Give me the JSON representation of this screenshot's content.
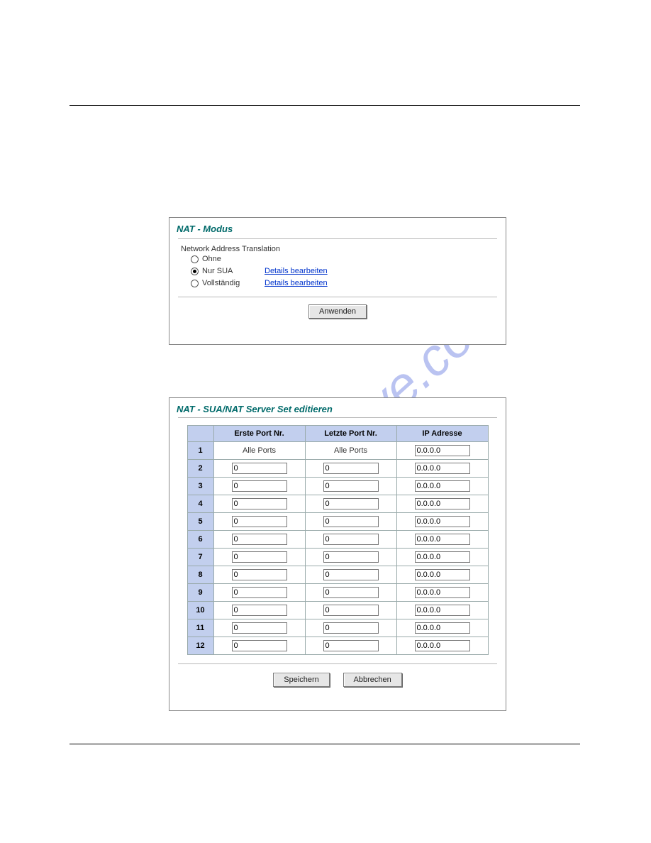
{
  "watermark_text": "manualshive.com",
  "nat_modus": {
    "title": "NAT - Modus",
    "section_label": "Network Address Translation",
    "options": [
      {
        "label": "Ohne",
        "checked": false,
        "details": ""
      },
      {
        "label": "Nur SUA",
        "checked": true,
        "details": "Details bearbeiten"
      },
      {
        "label": "Vollständig",
        "checked": false,
        "details": "Details bearbeiten"
      }
    ],
    "apply_label": "Anwenden"
  },
  "server_set": {
    "title": "NAT - SUA/NAT Server Set editieren",
    "headers": {
      "index": "",
      "first_port": "Erste Port Nr.",
      "last_port": "Letzte Port Nr.",
      "ip": "IP Adresse"
    },
    "all_ports_label": "Alle Ports",
    "rows": [
      {
        "n": "1",
        "first": "Alle Ports",
        "last": "Alle Ports",
        "ip": "0.0.0.0",
        "all": true
      },
      {
        "n": "2",
        "first": "0",
        "last": "0",
        "ip": "0.0.0.0",
        "all": false
      },
      {
        "n": "3",
        "first": "0",
        "last": "0",
        "ip": "0.0.0.0",
        "all": false
      },
      {
        "n": "4",
        "first": "0",
        "last": "0",
        "ip": "0.0.0.0",
        "all": false
      },
      {
        "n": "5",
        "first": "0",
        "last": "0",
        "ip": "0.0.0.0",
        "all": false
      },
      {
        "n": "6",
        "first": "0",
        "last": "0",
        "ip": "0.0.0.0",
        "all": false
      },
      {
        "n": "7",
        "first": "0",
        "last": "0",
        "ip": "0.0.0.0",
        "all": false
      },
      {
        "n": "8",
        "first": "0",
        "last": "0",
        "ip": "0.0.0.0",
        "all": false
      },
      {
        "n": "9",
        "first": "0",
        "last": "0",
        "ip": "0.0.0.0",
        "all": false
      },
      {
        "n": "10",
        "first": "0",
        "last": "0",
        "ip": "0.0.0.0",
        "all": false
      },
      {
        "n": "11",
        "first": "0",
        "last": "0",
        "ip": "0.0.0.0",
        "all": false
      },
      {
        "n": "12",
        "first": "0",
        "last": "0",
        "ip": "0.0.0.0",
        "all": false
      }
    ],
    "save_label": "Speichern",
    "cancel_label": "Abbrechen"
  }
}
